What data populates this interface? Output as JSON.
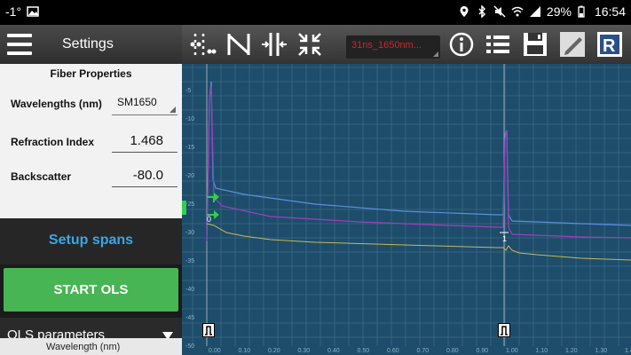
{
  "status": {
    "temperature": "-1°",
    "battery": "29%",
    "time": "16:54"
  },
  "left": {
    "title": "Settings",
    "fiber": {
      "title": "Fiber Properties",
      "wavelength_label": "Wavelengths (nm)",
      "wavelength_value": "SM1650",
      "refraction_label": "Refraction Index",
      "refraction_value": "1.468",
      "backscatter_label": "Backscatter",
      "backscatter_value": "-80.0"
    },
    "setup_spans": "Setup spans",
    "start_ols": "START OLS",
    "ols_params": "OLS parameters",
    "bottom_text": "Wavelength (nm)"
  },
  "toolbar": {
    "dropdown_value": "31ns_1650nm...",
    "icons": [
      "markers-icon",
      "splice-icon",
      "pulse-icon",
      "zoom-fit-icon",
      "info-icon",
      "list-icon",
      "save-icon",
      "edit-icon",
      "report-icon"
    ]
  },
  "plot": {
    "y_ticks": [
      "-5",
      "-10",
      "-15",
      "-20",
      "-25",
      "-30",
      "-35",
      "-40",
      "-45",
      "-50"
    ],
    "x_ticks": [
      "0.00",
      "0.10",
      "0.20",
      "0.30",
      "0.40",
      "0.50",
      "0.60",
      "0.70",
      "0.80",
      "0.90",
      "1.00",
      "1.10",
      "1.20",
      "1.30",
      "1.40"
    ],
    "event_labels": [
      "0",
      "1"
    ],
    "colors": {
      "background": "#1d4d6a",
      "grid": "#3c6a87",
      "trace_blue": "#5b8fe0",
      "trace_purple": "#a03ec0",
      "trace_yellow": "#c9b85a",
      "marker_green": "#2fd04a"
    }
  }
}
